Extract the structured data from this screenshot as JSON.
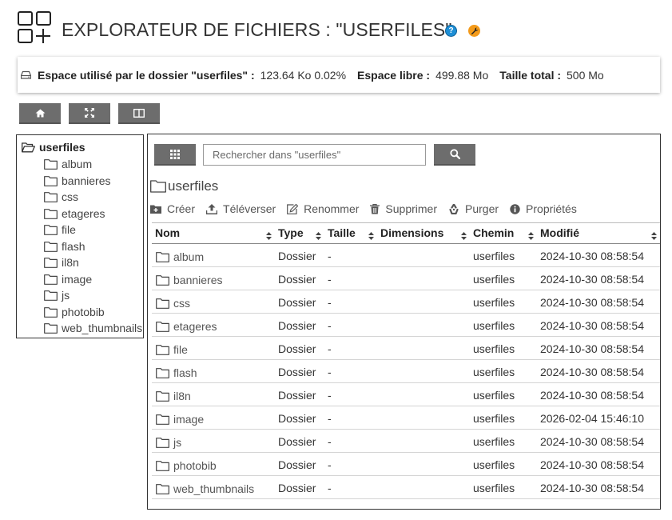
{
  "header": {
    "title": "EXPLORATEUR DE FICHIERS : \"USERFILES\"",
    "help_icon": "question-circle-icon",
    "settings_icon": "wrench-icon",
    "accent_help": "#1e8fd6",
    "accent_settings": "#f39a1a"
  },
  "usage": {
    "used_label": "Espace utilisé par le dossier \"userfiles\" :",
    "used_value": "123.64 Ko 0.02%",
    "free_label": "Espace libre :",
    "free_value": "499.88 Mo",
    "total_label": "Taille total :",
    "total_value": "500 Mo"
  },
  "tree": {
    "root": "userfiles",
    "items": [
      "album",
      "bannieres",
      "css",
      "etageres",
      "file",
      "flash",
      "il8n",
      "image",
      "js",
      "photobib",
      "web_thumbnails"
    ]
  },
  "search": {
    "placeholder": "Rechercher dans \"userfiles\""
  },
  "current_folder": "userfiles",
  "actions": [
    "Créer",
    "Téléverser",
    "Renommer",
    "Supprimer",
    "Purger",
    "Propriétés"
  ],
  "table": {
    "headers": [
      "Nom",
      "Type",
      "Taille",
      "Dimensions",
      "Chemin",
      "Modifié"
    ],
    "rows": [
      {
        "name": "album",
        "type": "Dossier",
        "size": "-",
        "dimensions": "",
        "path": "userfiles",
        "modified": "2024-10-30 08:58:54"
      },
      {
        "name": "bannieres",
        "type": "Dossier",
        "size": "-",
        "dimensions": "",
        "path": "userfiles",
        "modified": "2024-10-30 08:58:54"
      },
      {
        "name": "css",
        "type": "Dossier",
        "size": "-",
        "dimensions": "",
        "path": "userfiles",
        "modified": "2024-10-30 08:58:54"
      },
      {
        "name": "etageres",
        "type": "Dossier",
        "size": "-",
        "dimensions": "",
        "path": "userfiles",
        "modified": "2024-10-30 08:58:54"
      },
      {
        "name": "file",
        "type": "Dossier",
        "size": "-",
        "dimensions": "",
        "path": "userfiles",
        "modified": "2024-10-30 08:58:54"
      },
      {
        "name": "flash",
        "type": "Dossier",
        "size": "-",
        "dimensions": "",
        "path": "userfiles",
        "modified": "2024-10-30 08:58:54"
      },
      {
        "name": "il8n",
        "type": "Dossier",
        "size": "-",
        "dimensions": "",
        "path": "userfiles",
        "modified": "2024-10-30 08:58:54"
      },
      {
        "name": "image",
        "type": "Dossier",
        "size": "-",
        "dimensions": "",
        "path": "userfiles",
        "modified": "2026-02-04 15:46:10"
      },
      {
        "name": "js",
        "type": "Dossier",
        "size": "-",
        "dimensions": "",
        "path": "userfiles",
        "modified": "2024-10-30 08:58:54"
      },
      {
        "name": "photobib",
        "type": "Dossier",
        "size": "-",
        "dimensions": "",
        "path": "userfiles",
        "modified": "2024-10-30 08:58:54"
      },
      {
        "name": "web_thumbnails",
        "type": "Dossier",
        "size": "-",
        "dimensions": "",
        "path": "userfiles",
        "modified": "2024-10-30 08:58:54"
      }
    ]
  }
}
